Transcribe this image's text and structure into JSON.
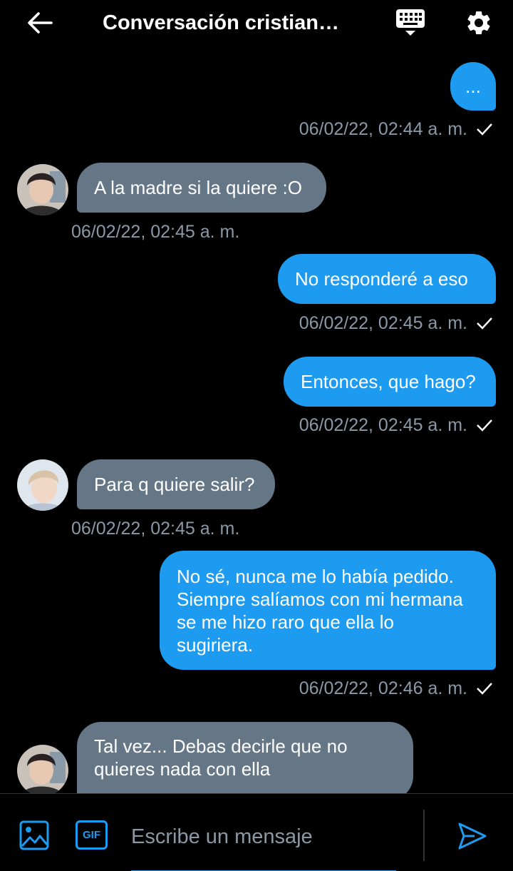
{
  "header": {
    "title": "Conversación cristian…",
    "back_icon": "arrow-left-icon",
    "keyboard_icon": "keyboard-icon",
    "settings_icon": "gear-icon"
  },
  "messages": [
    {
      "side": "sent",
      "text": "...",
      "time": "06/02/22, 02:44 a. m.",
      "read": true
    },
    {
      "side": "received",
      "text": "A la madre si la quiere :O",
      "time": "06/02/22, 02:45 a. m."
    },
    {
      "side": "sent",
      "text": "No responderé a eso",
      "time": "06/02/22, 02:45 a. m.",
      "read": true
    },
    {
      "side": "sent",
      "text": "Entonces, que hago?",
      "time": "06/02/22, 02:45 a. m.",
      "read": true
    },
    {
      "side": "received",
      "text": "Para q quiere salir?",
      "time": "06/02/22, 02:45 a. m."
    },
    {
      "side": "sent",
      "lines": [
        "No sé, nunca me lo había pedido.",
        "Siempre salíamos con mi hermana",
        "se me hizo raro que ella lo",
        "sugiriera."
      ],
      "time": "06/02/22, 02:46 a. m.",
      "read": true
    },
    {
      "side": "received",
      "lines": [
        "Tal vez... Debas decirle que no",
        "quieres nada con ella"
      ]
    }
  ],
  "composer": {
    "placeholder": "Escribe un mensaje",
    "gif_label": "GIF",
    "media_icon": "image-icon",
    "send_icon": "send-icon"
  },
  "colors": {
    "background": "#000000",
    "sent_bubble": "#1d9bf0",
    "received_bubble": "#657786",
    "timestamp": "#8b98a5",
    "accent": "#1d9bf0"
  }
}
